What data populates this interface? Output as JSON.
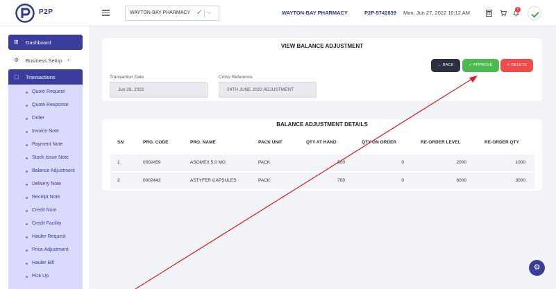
{
  "app": {
    "logo_text": "P2P"
  },
  "header": {
    "pharmacy_select": "WAYTON-BAY PHARMACY",
    "pharmacy_name": "WAYTON-BAY PHARMACY",
    "code": "P2P-5742839",
    "datetime": "Mon, Jun 27, 2022 10:12 AM",
    "notification_count": "1",
    "icons": [
      "menu-icon",
      "calculator-icon",
      "cart-icon",
      "bell-icon",
      "avatar"
    ]
  },
  "sidebar": {
    "dashboard": "Dashboard",
    "business_setup": "Business Setup",
    "transactions": "Transactions",
    "items": [
      "Quote Request",
      "Quote Response",
      "Order",
      "Invoice Note",
      "Payment Note",
      "Stock Issue Note",
      "Balance Adjustment",
      "Delivery Note",
      "Receipt Note",
      "Credit Note",
      "Credit Facility",
      "Hauler Request",
      "Price Adjustment",
      "Hauler Bill",
      "Pick Up"
    ]
  },
  "view": {
    "title": "VIEW BALANCE ADJUSTMENT",
    "back_label": "BACK",
    "approve_label": "APPROVE",
    "delete_label": "DELETE",
    "transaction_date_label": "Transaction Date",
    "transaction_date_value": "Jun 26, 2022",
    "cross_reference_label": "Cross Reference",
    "cross_reference_value": "24TH JUNE 2022 ADJUSTMENT"
  },
  "details": {
    "title": "BALANCE ADJUSTMENT DETAILS",
    "columns": [
      "SN",
      "PRO. CODE",
      "PRO. NAME",
      "PACK UNIT",
      "QTY AT HAND",
      "QTY ON ORDER",
      "RE-ORDER LEVEL",
      "RE-ORDER QTY"
    ],
    "rows": [
      [
        "1",
        "0002459",
        "ASOMEX 5.0 MG",
        "PACK",
        "500",
        "0",
        "2000",
        "1000"
      ],
      [
        "2",
        "0002443",
        "ASTYFER CAPSULES",
        "PACK",
        "700",
        "0",
        "6000",
        "3000"
      ]
    ]
  },
  "colors": {
    "brand": "#3b3d9c",
    "approve": "#4cba4f",
    "delete": "#ef4b4b",
    "back": "#2d3040",
    "annotation": "#e02020"
  }
}
